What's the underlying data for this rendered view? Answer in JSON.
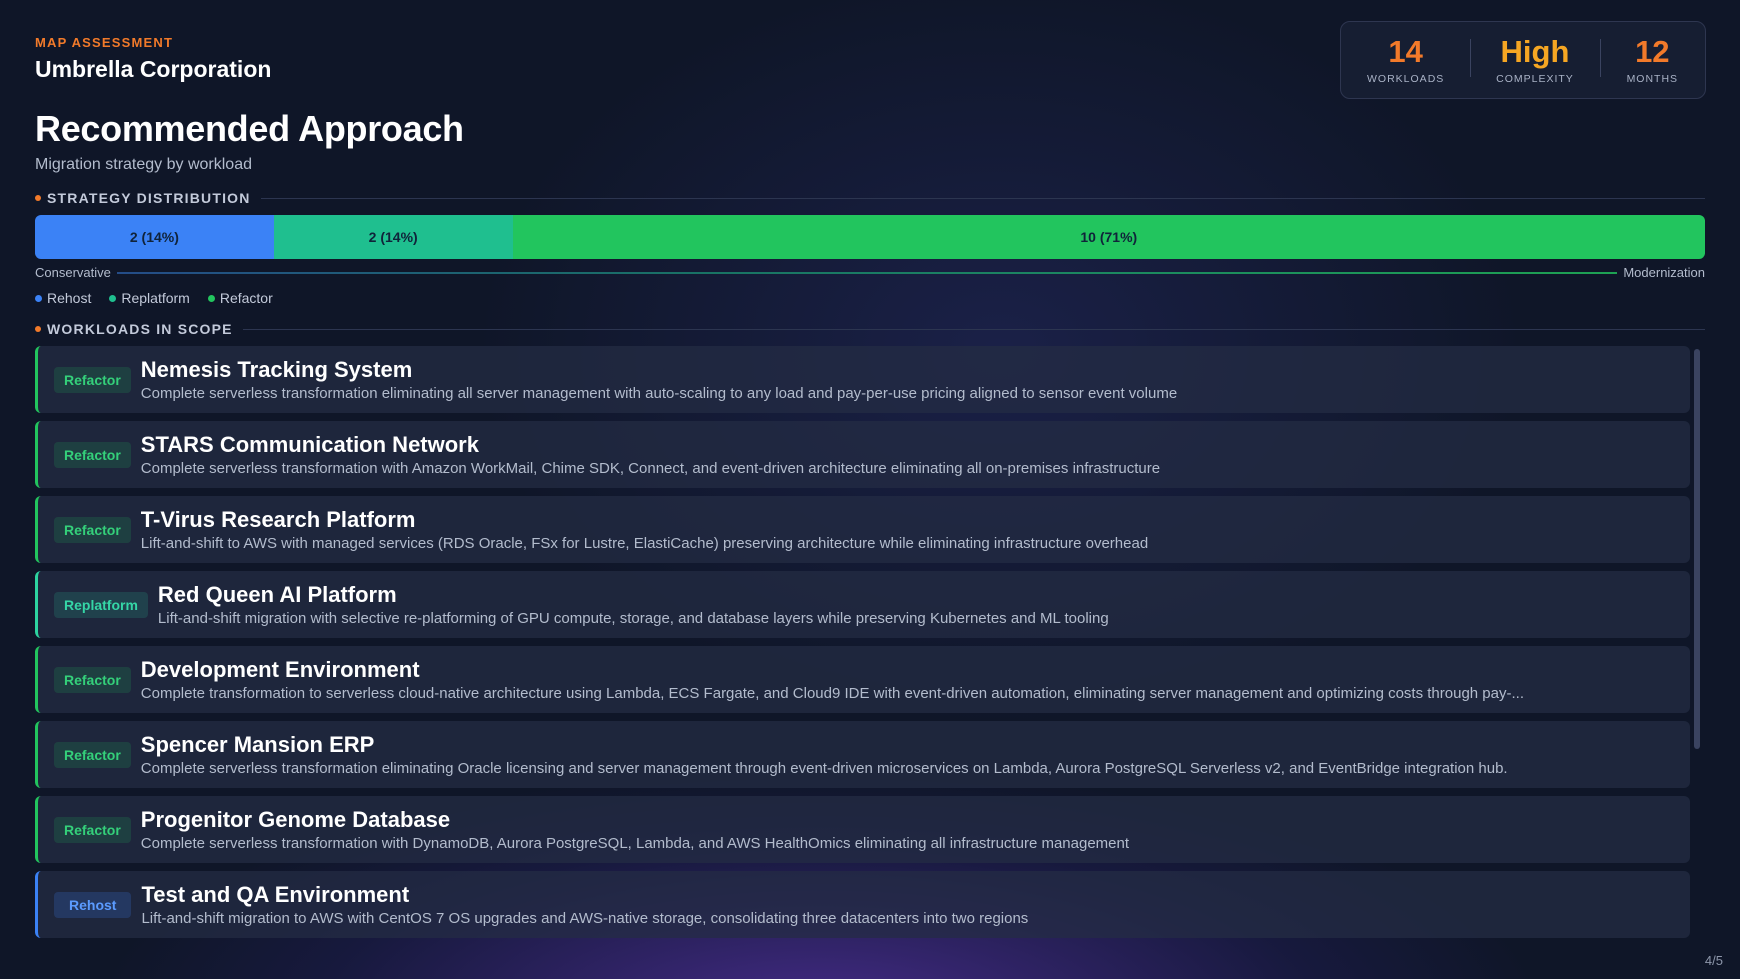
{
  "header": {
    "eyebrow": "MAP ASSESSMENT",
    "organization": "Umbrella Corporation"
  },
  "stats": [
    {
      "value": "14",
      "label": "WORKLOADS",
      "color": "#f27a2a"
    },
    {
      "value": "High",
      "label": "COMPLEXITY",
      "color": "#f5a623"
    },
    {
      "value": "12",
      "label": "MONTHS",
      "color": "#f27a2a"
    }
  ],
  "title": "Recommended Approach",
  "subtitle": "Migration strategy by workload",
  "distribution": {
    "section_label": "STRATEGY DISTRIBUTION",
    "segments": [
      {
        "name": "Rehost",
        "label": "2 (14%)",
        "count": 2,
        "percent": 14.3,
        "color": "#3b82f6"
      },
      {
        "name": "Replatform",
        "label": "2 (14%)",
        "count": 2,
        "percent": 14.3,
        "color": "#1fbf8f"
      },
      {
        "name": "Refactor",
        "label": "10 (71%)",
        "count": 10,
        "percent": 71.4,
        "color": "#22c55e"
      }
    ],
    "axis_left": "Conservative",
    "axis_right": "Modernization",
    "legend": [
      {
        "name": "Rehost",
        "color": "#3b82f6"
      },
      {
        "name": "Replatform",
        "color": "#1fbf8f"
      },
      {
        "name": "Refactor",
        "color": "#22c55e"
      }
    ]
  },
  "workloads": {
    "section_label": "WORKLOADS IN SCOPE",
    "items": [
      {
        "strategy": "Refactor",
        "name": "Nemesis Tracking System",
        "description": "Complete serverless transformation eliminating all server management with auto-scaling to any load and pay-per-use pricing aligned to sensor event volume"
      },
      {
        "strategy": "Refactor",
        "name": "STARS Communication Network",
        "description": "Complete serverless transformation with Amazon WorkMail, Chime SDK, Connect, and event-driven architecture eliminating all on-premises infrastructure"
      },
      {
        "strategy": "Refactor",
        "name": "T-Virus Research Platform",
        "description": "Lift-and-shift to AWS with managed services (RDS Oracle, FSx for Lustre, ElastiCache) preserving architecture while eliminating infrastructure overhead"
      },
      {
        "strategy": "Replatform",
        "name": "Red Queen AI Platform",
        "description": "Lift-and-shift migration with selective re-platforming of GPU compute, storage, and database layers while preserving Kubernetes and ML tooling"
      },
      {
        "strategy": "Refactor",
        "name": "Development Environment",
        "description": "Complete transformation to serverless cloud-native architecture using Lambda, ECS Fargate, and Cloud9 IDE with event-driven automation, eliminating server management and optimizing costs through pay-..."
      },
      {
        "strategy": "Refactor",
        "name": "Spencer Mansion ERP",
        "description": "Complete serverless transformation eliminating Oracle licensing and server management through event-driven microservices on Lambda, Aurora PostgreSQL Serverless v2, and EventBridge integration hub."
      },
      {
        "strategy": "Refactor",
        "name": "Progenitor Genome Database",
        "description": "Complete serverless transformation with DynamoDB, Aurora PostgreSQL, Lambda, and AWS HealthOmics eliminating all infrastructure management"
      },
      {
        "strategy": "Rehost",
        "name": "Test and QA Environment",
        "description": "Lift-and-shift migration to AWS with CentOS 7 OS upgrades and AWS-native storage, consolidating three datacenters into two regions"
      }
    ]
  },
  "page_indicator": "4/5"
}
